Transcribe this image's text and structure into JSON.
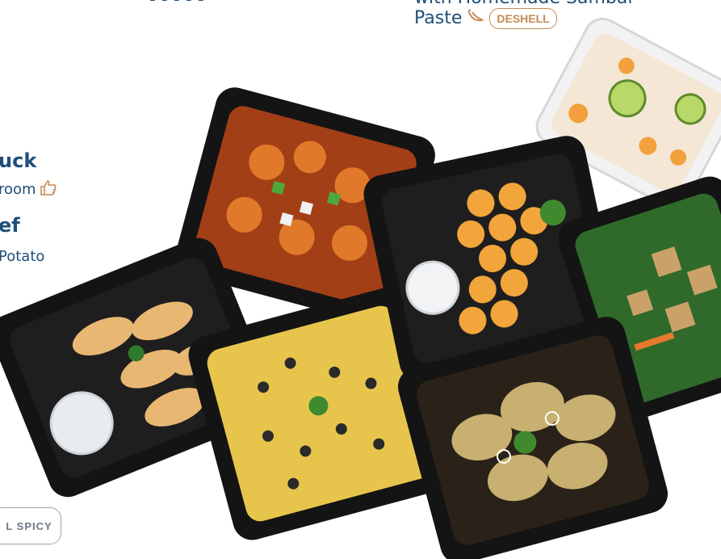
{
  "top_left_fragment": "- - - - -",
  "right_item": {
    "line1": "with Homemade Sambal",
    "line2": "Paste",
    "chili_icon": "chili-icon",
    "badge": "DESHELL"
  },
  "left_top": {
    "title": "uck",
    "subtitle": "room",
    "thumb_icon": "thumbs-up-icon"
  },
  "left_bottom": {
    "title": "ef",
    "subtitle": "Potato"
  },
  "spicy_button": "L SPICY",
  "colors": {
    "text_blue": "#1f4e7a",
    "badge_brown": "#c58a54",
    "tray": "#141414"
  }
}
